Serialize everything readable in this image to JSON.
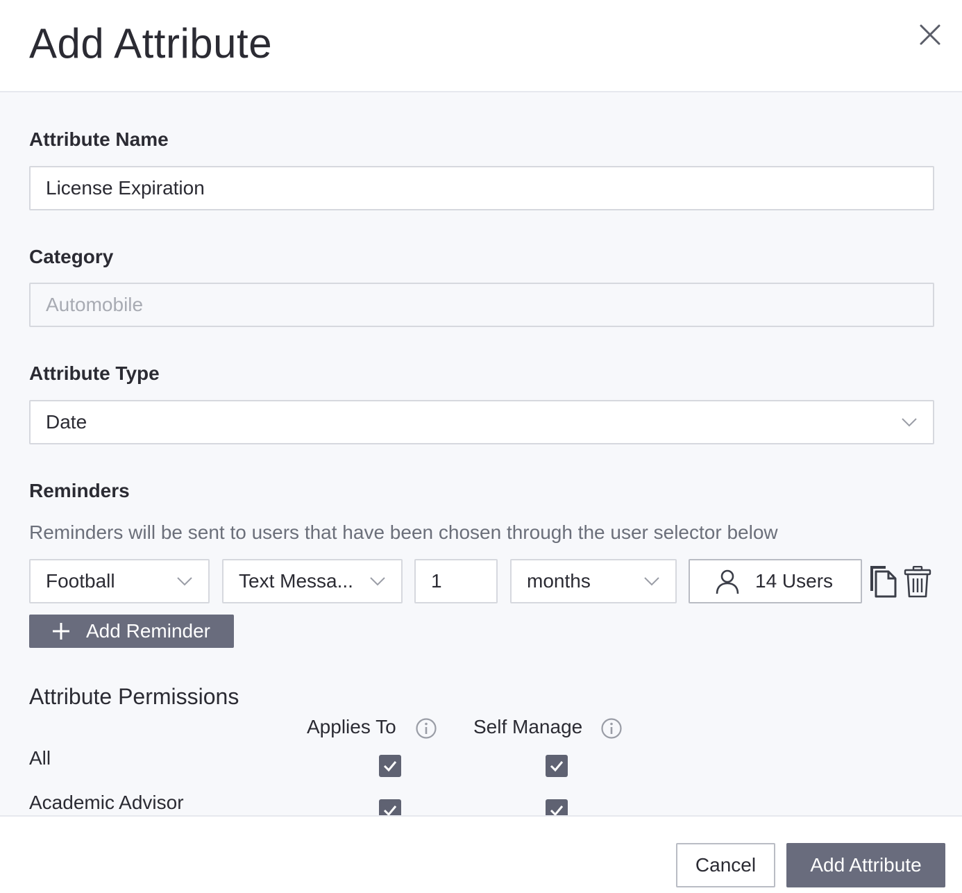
{
  "dialog": {
    "title": "Add Attribute",
    "close_icon": "close-icon"
  },
  "form": {
    "attribute_name": {
      "label": "Attribute Name",
      "value": "License Expiration"
    },
    "category": {
      "label": "Category",
      "placeholder": "Automobile"
    },
    "attribute_type": {
      "label": "Attribute Type",
      "value": "Date"
    }
  },
  "reminders": {
    "label": "Reminders",
    "hint": "Reminders will be sent to users that have been chosen through the user selector below",
    "items": [
      {
        "group": "Football",
        "method": "Text Messa...",
        "amount": "1",
        "unit": "months",
        "users": "14 Users"
      }
    ],
    "add_label": "Add Reminder"
  },
  "permissions": {
    "title": "Attribute Permissions",
    "columns": [
      "Applies To",
      "Self Manage"
    ],
    "rows": [
      {
        "label": "All",
        "applies_to": true,
        "self_manage": true
      },
      {
        "label": "Academic Advisor",
        "applies_to": true,
        "self_manage": true
      }
    ]
  },
  "footer": {
    "cancel_label": "Cancel",
    "submit_label": "Add Attribute"
  },
  "colors": {
    "primary_button": "#696c7d",
    "checkbox": "#5f6272",
    "body_bg": "#f7f8fb",
    "border": "#d6d8de"
  }
}
